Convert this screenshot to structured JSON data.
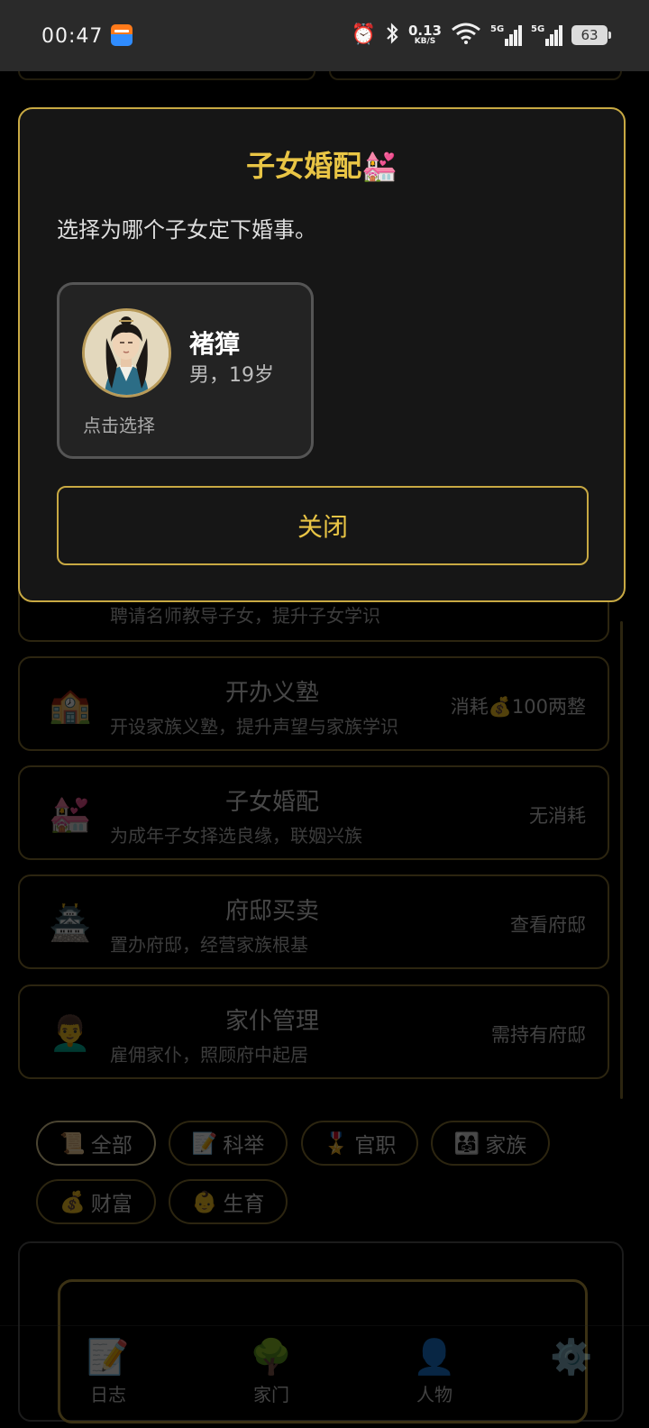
{
  "status_bar": {
    "time": "00:47",
    "net_speed_value": "0.13",
    "net_speed_unit": "KB/S",
    "signal_1_label": "5G",
    "signal_2_label": "5G",
    "battery": "63"
  },
  "modal": {
    "title": "子女婚配",
    "title_emoji": "💒",
    "subtitle": "选择为哪个子女定下婚事。",
    "children": [
      {
        "name": "褚獐",
        "info": "男，19岁",
        "hint": "点击选择"
      }
    ],
    "close_label": "关闭"
  },
  "background": {
    "activities": [
      {
        "icon": "",
        "title": "",
        "desc": "聘请名师教导子女，提升子女学识",
        "cost": ""
      },
      {
        "icon": "🏫",
        "title": "开办义塾",
        "desc": "开设家族义塾，提升声望与家族学识",
        "cost": "消耗💰100两整"
      },
      {
        "icon": "💒",
        "title": "子女婚配",
        "desc": "为成年子女择选良缘，联姻兴族",
        "cost": "无消耗"
      },
      {
        "icon": "🏯",
        "title": "府邸买卖",
        "desc": "置办府邸，经营家族根基",
        "cost": "查看府邸"
      },
      {
        "icon": "👨‍🦱",
        "title": "家仆管理",
        "desc": "雇佣家仆，照顾府中起居",
        "cost": "需持有府邸"
      }
    ],
    "filters": [
      {
        "icon": "📜",
        "label": "全部"
      },
      {
        "icon": "📝",
        "label": "科举"
      },
      {
        "icon": "🎖️",
        "label": "官职"
      },
      {
        "icon": "👨‍👩‍👧",
        "label": "家族"
      },
      {
        "icon": "💰",
        "label": "财富"
      },
      {
        "icon": "👶",
        "label": "生育"
      }
    ]
  },
  "bottom_nav": [
    {
      "icon": "📝",
      "label": "日志"
    },
    {
      "icon": "🌳",
      "label": "家门"
    },
    {
      "icon": "👤",
      "label": "人物"
    },
    {
      "icon": "⚙️",
      "label": ""
    }
  ]
}
